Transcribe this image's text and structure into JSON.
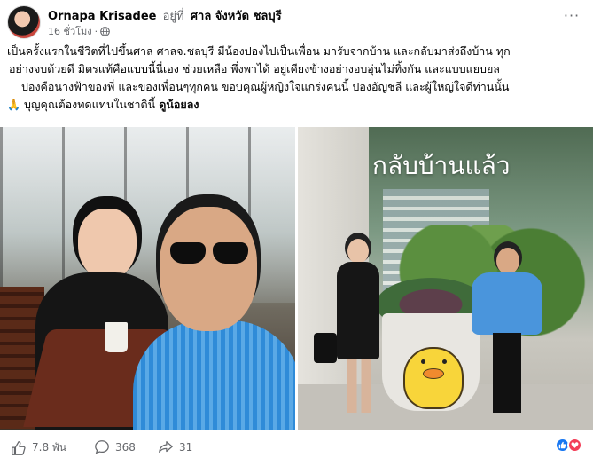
{
  "post": {
    "author": "Ornapa Krisadee",
    "at_text": "อยู่ที่",
    "place": "ศาล จังหวัด ชลบุรี",
    "time": "16 ชั่วโมง",
    "more": "···",
    "body": {
      "line1": "เป็นครั้งแรกในชีวิตที่ไปขึ้นศาล ศาลจ.ชลบุรี มีน้องปองไปเป็นเพื่อน มารับจากบ้าน และกลับมาส่งถึงบ้าน ทุก",
      "line2": "อย่างจบด้วยดี มิตรแท้คือแบบนี้นี่เอง ช่วยเหลือ พึ่งพาได้ อยู่เคียงข้างอย่างอบอุ่นไม่ทิ้งกัน และแบบแยบยล",
      "line3": "ปองคือนางฟ้าของพี่ และของเพื่อนๆทุกคน ขอบคุณผู้หญิงใจแกร่งคนนี้ ปองอัญชลี และผู้ใหญ่ใจดีท่านนั้น",
      "line4": "บุญคุณต้องทดแทนในชาตินี้",
      "tag": "ดูน้อยลง",
      "pray_emoji": "🙏"
    }
  },
  "photos": {
    "right_caption": "กลับบ้านแล้ว"
  },
  "footer": {
    "likes": "7.8 พัน",
    "comments": "368",
    "shares": "31"
  },
  "icons": {
    "globe": "globe-icon",
    "like": "thumbs-up-icon",
    "comment": "comment-icon",
    "share": "share-icon"
  },
  "colors": {
    "like_blue": "#1877f2",
    "love_red": "#f33e58",
    "meta_gray": "#65676b"
  }
}
